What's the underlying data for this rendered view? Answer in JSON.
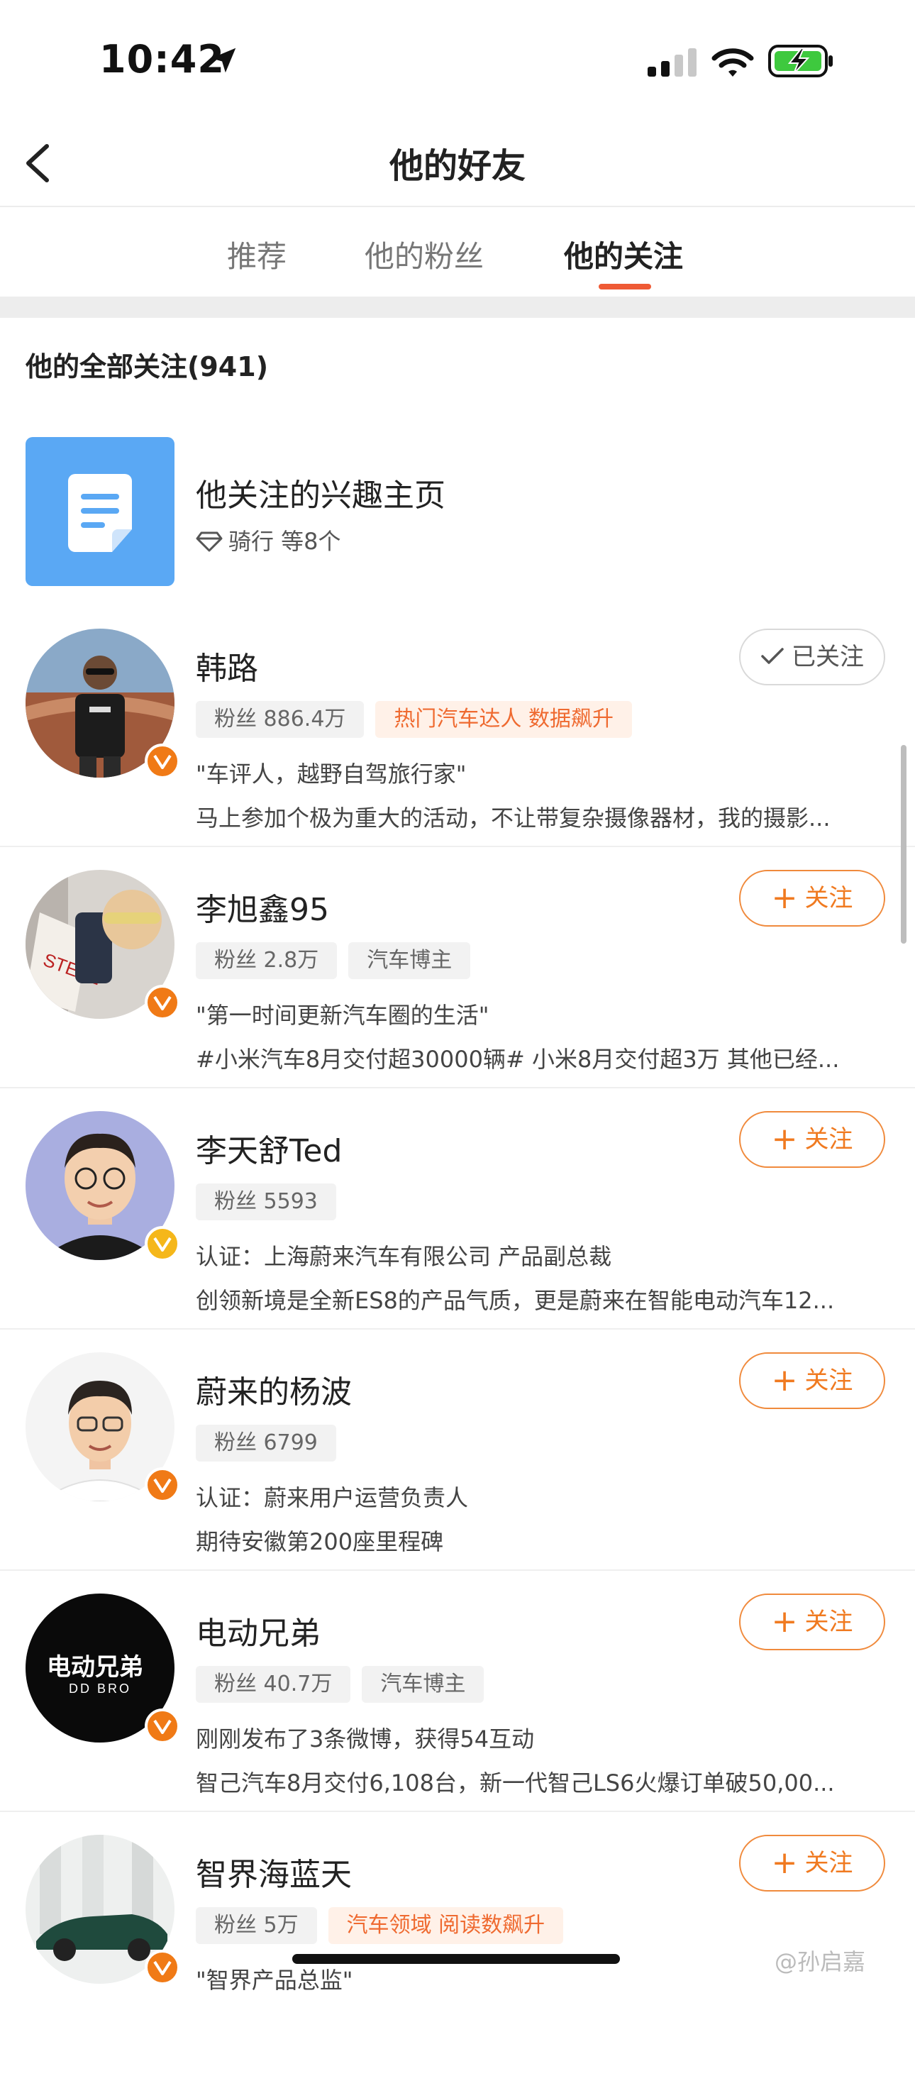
{
  "status_bar": {
    "time": "10:42"
  },
  "nav": {
    "title": "他的好友"
  },
  "tabs": [
    {
      "label": "推荐"
    },
    {
      "label": "他的粉丝"
    },
    {
      "label": "他的关注",
      "active": true
    }
  ],
  "section": {
    "title": "他的全部关注(941)"
  },
  "interest": {
    "title": "他关注的兴趣主页",
    "subtitle": "骑行 等8个"
  },
  "users": [
    {
      "name": "韩路",
      "button": "已关注",
      "button_state": "followed",
      "fans": "粉丝 886.4万",
      "tag": "热门汽车达人 数据飙升",
      "tag_hot": true,
      "line1": "\"车评人，越野自驾旅行家\"",
      "line2": "马上参加个极为重大的活动，不让带复杂摄像器材，我的摄影...",
      "badge": "orange"
    },
    {
      "name": "李旭鑫95",
      "button": "关注",
      "button_state": "follow",
      "fans": "粉丝 2.8万",
      "tag": "汽车博主",
      "tag_hot": false,
      "line1": "\"第一时间更新汽车圈的生活\"",
      "line2": "#小米汽车8月交付超30000辆# 小米8月交付超3万 其他已经...",
      "badge": "orange"
    },
    {
      "name": "李天舒Ted",
      "button": "关注",
      "button_state": "follow",
      "fans": "粉丝 5593",
      "tag": "",
      "tag_hot": false,
      "line1": "认证：上海蔚来汽车有限公司 产品副总裁",
      "line2": "创领新境是全新ES8的产品气质，更是蔚来在智能电动汽车12...",
      "badge": "gold"
    },
    {
      "name": "蔚来的杨波",
      "button": "关注",
      "button_state": "follow",
      "fans": "粉丝 6799",
      "tag": "",
      "tag_hot": false,
      "line1": "认证：蔚来用户运营负责人",
      "line2": "期待安徽第200座里程碑",
      "badge": "orange"
    },
    {
      "name": "电动兄弟",
      "button": "关注",
      "button_state": "follow",
      "fans": "粉丝 40.7万",
      "tag": "汽车博主",
      "tag_hot": false,
      "line1": "刚刚发布了3条微博，获得54互动",
      "line2": "智己汽车8月交付6,108台，新一代智己LS6火爆订单破50,00...",
      "badge": "orange"
    },
    {
      "name": "智界海蓝天",
      "button": "关注",
      "button_state": "follow",
      "fans": "粉丝 5万",
      "tag": "汽车领域 阅读数飙升",
      "tag_hot": true,
      "line1": "\"智界产品总监\"",
      "line2": "",
      "badge": "orange"
    }
  ],
  "avatar_logo": {
    "top": "电动兄弟",
    "bottom": "DD BRO"
  },
  "watermark": "@孙启嘉",
  "colors": {
    "accent": "#ef5a35",
    "follow": "#f07a20",
    "badge_orange": "#f07a16",
    "badge_gold": "#f5b71a",
    "interest_tile": "#5aa8f4"
  }
}
